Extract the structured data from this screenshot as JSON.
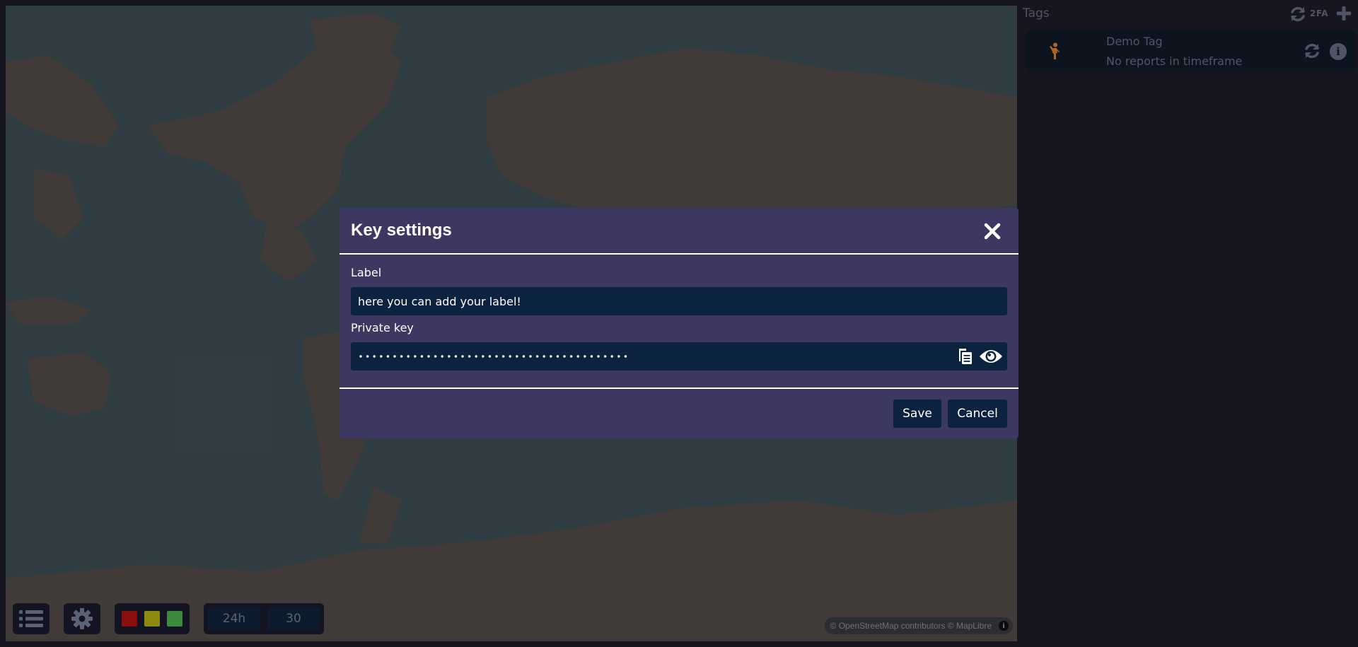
{
  "sidebar": {
    "title": "Tags",
    "twofa_label": "2FA",
    "tags": [
      {
        "name": "Demo Tag",
        "status": "No reports in timeframe",
        "avatar_icon": "person-icon",
        "avatar_color": "#b3651c"
      }
    ]
  },
  "map": {
    "attribution": "© OpenStreetMap contributors © MapLibre",
    "controls": {
      "list_icon": "list-icon",
      "gear_icon": "gear-icon",
      "colors": [
        "#8b0f0f",
        "#8c8a10",
        "#3f8a3f"
      ],
      "time_window": "24h",
      "count": "30"
    }
  },
  "modal": {
    "title": "Key settings",
    "label_field": {
      "label": "Label",
      "value": "here you can add your label!"
    },
    "private_key_field": {
      "label": "Private key",
      "masked_length": 40
    },
    "save_label": "Save",
    "cancel_label": "Cancel"
  }
}
